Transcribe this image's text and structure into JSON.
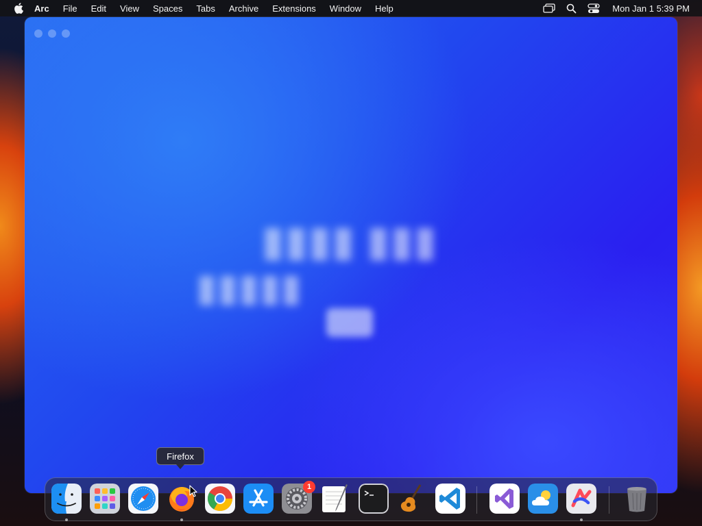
{
  "menubar": {
    "app_name": "Arc",
    "items": [
      "File",
      "Edit",
      "View",
      "Spaces",
      "Tabs",
      "Archive",
      "Extensions",
      "Window",
      "Help"
    ],
    "clock": "Mon Jan 1  5:39 PM"
  },
  "window": {
    "app": "Arc"
  },
  "tooltip": {
    "label": "Firefox"
  },
  "dock": {
    "apps": [
      {
        "name": "Finder",
        "icon": "finder-icon",
        "running": true
      },
      {
        "name": "Launchpad",
        "icon": "launchpad-icon",
        "running": false
      },
      {
        "name": "Safari",
        "icon": "safari-icon",
        "running": false
      },
      {
        "name": "Firefox",
        "icon": "firefox-icon",
        "running": true
      },
      {
        "name": "Google Chrome",
        "icon": "chrome-icon",
        "running": false
      },
      {
        "name": "App Store",
        "icon": "app-store-icon",
        "running": false
      },
      {
        "name": "System Settings",
        "icon": "system-settings-icon",
        "running": false,
        "badge": "1"
      },
      {
        "name": "TextEdit",
        "icon": "textedit-icon",
        "running": false
      },
      {
        "name": "Terminal",
        "icon": "terminal-icon",
        "running": false
      },
      {
        "name": "GarageBand",
        "icon": "garageband-icon",
        "running": false
      },
      {
        "name": "Visual Studio Code",
        "icon": "vscode-icon",
        "running": false
      },
      {
        "name": "Visual Studio",
        "icon": "visual-studio-icon",
        "running": false
      },
      {
        "name": "Weather",
        "icon": "weather-icon",
        "running": false
      },
      {
        "name": "Arc",
        "icon": "arc-icon",
        "running": true
      },
      {
        "name": "Trash",
        "icon": "trash-icon",
        "running": false
      }
    ]
  },
  "colors": {
    "window_blue": "#2148ef",
    "badge_red": "#ff3b30",
    "wallpaper_orange": "#e8621a"
  }
}
